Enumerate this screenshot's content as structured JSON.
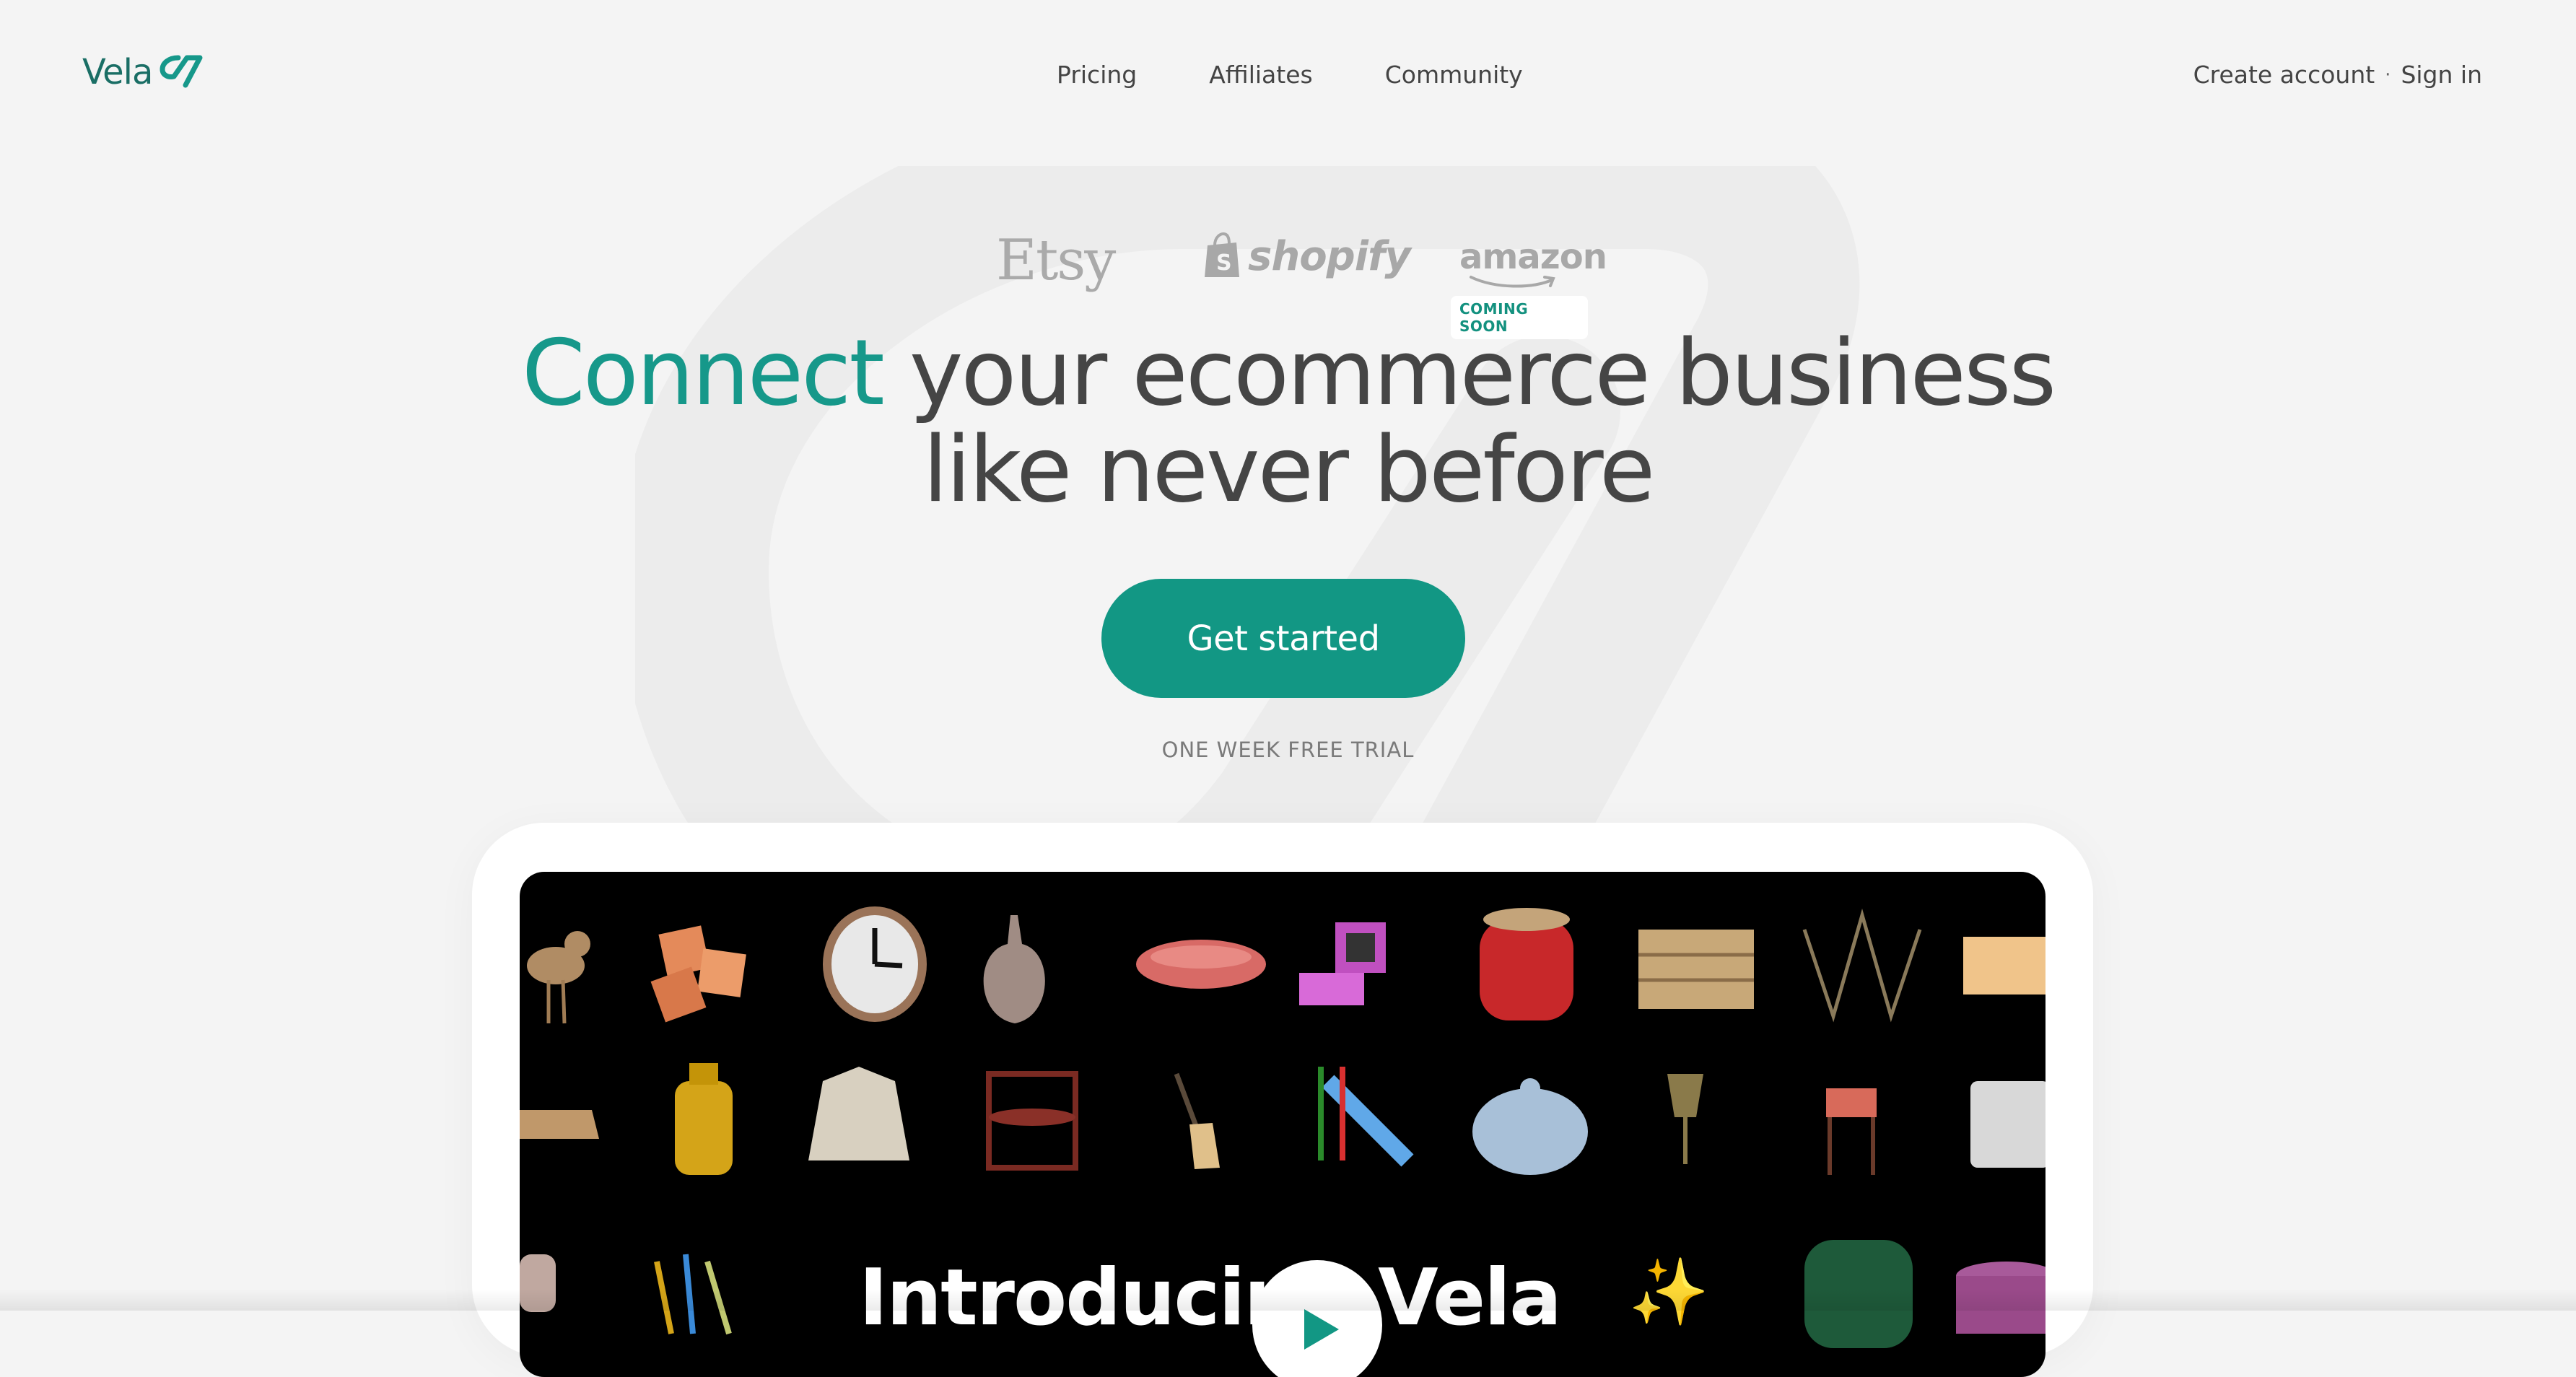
{
  "brand": {
    "name": "Vela",
    "accent": "#16988a"
  },
  "nav": {
    "items": [
      "Pricing",
      "Affiliates",
      "Community"
    ]
  },
  "auth": {
    "create_account": "Create account",
    "separator": "·",
    "sign_in": "Sign in"
  },
  "integrations": {
    "etsy": "Etsy",
    "shopify": "shopify",
    "amazon": "amazon",
    "amazon_badge": "COMING SOON"
  },
  "hero": {
    "headline_accent": "Connect",
    "headline_rest_line1": " your ecommerce business",
    "headline_line2": "like never before",
    "cta_label": "Get started",
    "trial_text": "ONE WEEK FREE TRIAL"
  },
  "video": {
    "title": "Introducing Vela",
    "sparkle": "✨",
    "play_icon": "play-icon"
  }
}
